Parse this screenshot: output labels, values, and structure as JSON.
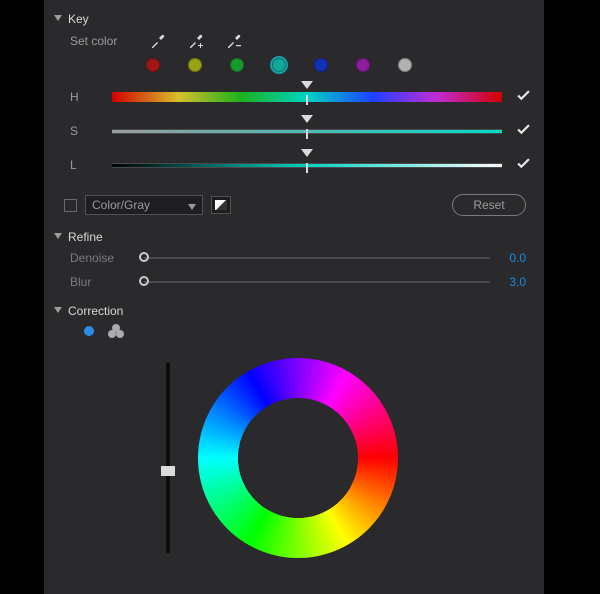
{
  "key": {
    "title": "Key",
    "set_color_label": "Set color",
    "swatches": [
      {
        "name": "red",
        "color": "#a21616",
        "selected": false
      },
      {
        "name": "olive",
        "color": "#9aa318",
        "selected": false
      },
      {
        "name": "green",
        "color": "#189a2d",
        "selected": false
      },
      {
        "name": "cyan",
        "color": "#12a79d",
        "selected": true
      },
      {
        "name": "blue",
        "color": "#1430b9",
        "selected": false
      },
      {
        "name": "magenta",
        "color": "#8c1e9c",
        "selected": false
      },
      {
        "name": "gray",
        "color": "#b1b2b4",
        "selected": false
      }
    ],
    "sliders": {
      "H": {
        "label": "H",
        "pos": 0.5,
        "checked": true
      },
      "S": {
        "label": "S",
        "pos": 0.5,
        "checked": true
      },
      "L": {
        "label": "L",
        "pos": 0.5,
        "checked": true
      }
    },
    "color_gray_checked": false,
    "preset_dropdown": "Color/Gray",
    "reset_label": "Reset"
  },
  "refine": {
    "title": "Refine",
    "denoise": {
      "label": "Denoise",
      "value": "0.0",
      "pos": 0.0
    },
    "blur": {
      "label": "Blur",
      "value": "3.0",
      "pos": 0.0
    }
  },
  "correction": {
    "title": "Correction",
    "mode_colors": {
      "single": "#2b8be6"
    },
    "luminance_thumb_pos": 0.57
  }
}
